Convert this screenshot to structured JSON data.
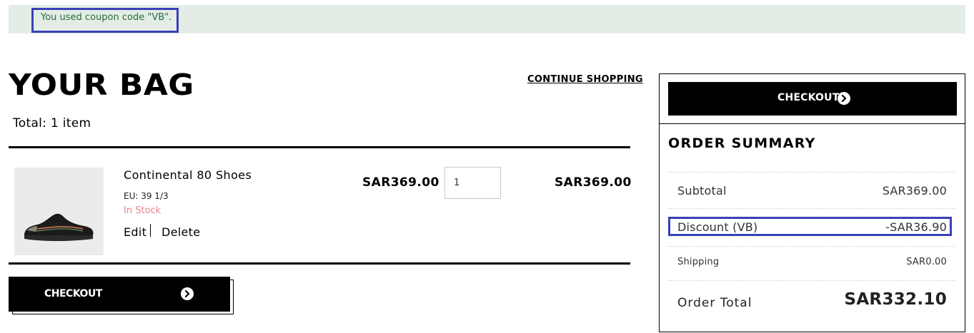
{
  "notice": {
    "message": "You used coupon code \"VB\"."
  },
  "bag": {
    "title": "YOUR BAG",
    "continue_label": "CONTINUE SHOPPING",
    "total_items": "Total: 1 item",
    "items": [
      {
        "name": "Continental 80 Shoes",
        "size": "EU: 39 1/3",
        "stock": "In Stock",
        "edit_label": "Edit",
        "delete_label": "Delete",
        "unit_price": "SAR369.00",
        "quantity": "1",
        "line_total": "SAR369.00",
        "image_icon": "sneaker-image"
      }
    ],
    "checkout_label": "CHECKOUT"
  },
  "summary": {
    "checkout_label": "CHECKOUT",
    "title": "ORDER SUMMARY",
    "subtotal_label": "Subtotal",
    "subtotal_value": "SAR369.00",
    "discount_label": "Discount (VB)",
    "discount_value": "-SAR36.90",
    "shipping_label": "Shipping",
    "shipping_value": "SAR0.00",
    "total_label": "Order Total",
    "total_value": "SAR332.10"
  },
  "colors": {
    "notice_bg": "#e3ede5",
    "notice_text": "#2a6a3a",
    "highlight_border": "#3a3fb8",
    "stock_color": "#e8858a",
    "button_bg": "#000000"
  }
}
